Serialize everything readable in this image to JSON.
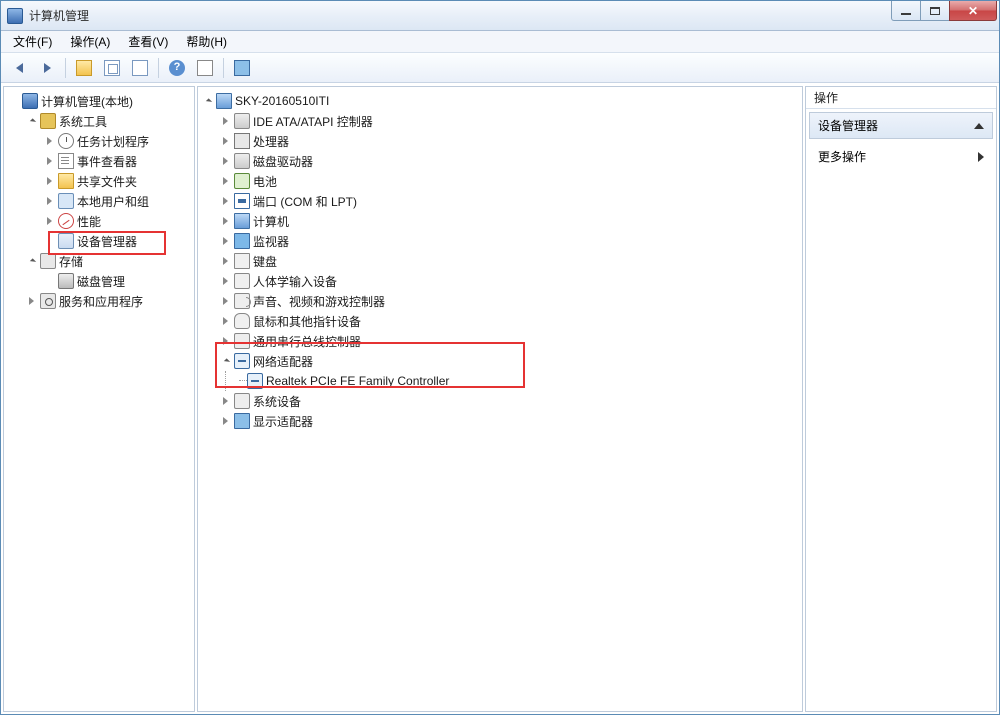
{
  "window": {
    "title": "计算机管理",
    "blurred_subtitle": "···"
  },
  "menu": {
    "file": "文件(F)",
    "action": "操作(A)",
    "view": "查看(V)",
    "help": "帮助(H)"
  },
  "left_tree": {
    "root": "计算机管理(本地)",
    "system_tools": "系统工具",
    "task_scheduler": "任务计划程序",
    "event_viewer": "事件查看器",
    "shared_folders": "共享文件夹",
    "local_users": "本地用户和组",
    "performance": "性能",
    "device_manager": "设备管理器",
    "storage": "存储",
    "disk_management": "磁盘管理",
    "services_apps": "服务和应用程序"
  },
  "center_tree": {
    "computer": "SKY-20160510ITI",
    "ide": "IDE ATA/ATAPI 控制器",
    "processor": "处理器",
    "disk_drive": "磁盘驱动器",
    "battery": "电池",
    "ports": "端口 (COM 和 LPT)",
    "computers": "计算机",
    "monitors": "监视器",
    "keyboard": "键盘",
    "hid": "人体学输入设备",
    "audio": "声音、视频和游戏控制器",
    "mouse": "鼠标和其他指针设备",
    "usb": "通用串行总线控制器",
    "network": "网络适配器",
    "network_device": "Realtek PCIe FE Family Controller",
    "system_devices": "系统设备",
    "display": "显示适配器"
  },
  "right_panel": {
    "header": "操作",
    "section": "设备管理器",
    "more_ops": "更多操作"
  }
}
